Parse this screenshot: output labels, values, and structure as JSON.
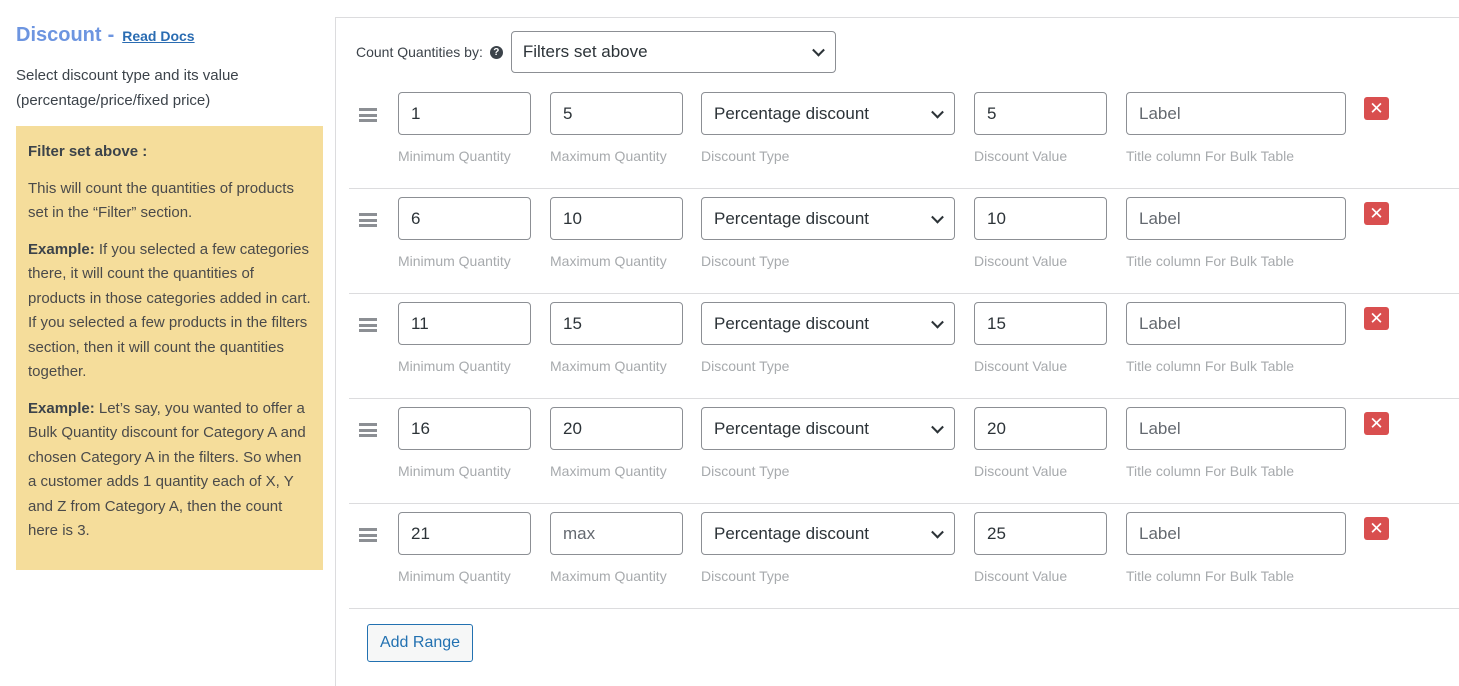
{
  "section": {
    "title": "Discount",
    "separator": "-",
    "docs_link": "Read Docs",
    "description": "Select discount type and its value (percentage/price/fixed price)"
  },
  "note": {
    "heading": "Filter set above :",
    "paragraph1": "This will count the quantities of products set in the “Filter” section.",
    "example1_label": "Example:",
    "example1_text": " If you selected a few categories there, it will count the quantities of products in those categories added in cart. If you selected a few products in the filters section, then it will count the quantities together.",
    "example2_label": "Example:",
    "example2_text": " Let’s say, you wanted to offer a Bulk Quantity discount for Category A and chosen Category A in the filters. So when a customer adds 1 quantity each of X, Y and Z from Category A, then the count here is 3."
  },
  "count_by": {
    "label": "Count Quantities by:",
    "help_icon": "question-circle-icon",
    "selected": "Filters set above"
  },
  "field_labels": {
    "min": "Minimum Quantity",
    "max": "Maximum Quantity",
    "type": "Discount Type",
    "value": "Discount Value",
    "title": "Title column For Bulk Table"
  },
  "ranges": [
    {
      "min": "1",
      "max": "5",
      "max_placeholder": "max",
      "type": "Percentage discount",
      "value": "5",
      "title": "",
      "title_placeholder": "Label"
    },
    {
      "min": "6",
      "max": "10",
      "max_placeholder": "max",
      "type": "Percentage discount",
      "value": "10",
      "title": "",
      "title_placeholder": "Label"
    },
    {
      "min": "11",
      "max": "15",
      "max_placeholder": "max",
      "type": "Percentage discount",
      "value": "15",
      "title": "",
      "title_placeholder": "Label"
    },
    {
      "min": "16",
      "max": "20",
      "max_placeholder": "max",
      "type": "Percentage discount",
      "value": "20",
      "title": "",
      "title_placeholder": "Label"
    },
    {
      "min": "21",
      "max": "",
      "max_placeholder": "max",
      "type": "Percentage discount",
      "value": "25",
      "title": "",
      "title_placeholder": "Label"
    }
  ],
  "icons": {
    "drag": "drag-handle-icon",
    "remove": "close-icon",
    "remove_glyph": "✕",
    "help_glyph": "?"
  },
  "add_button": "Add Range",
  "colors": {
    "title": "#6d95e0",
    "link": "#2a6cb2",
    "note_bg": "#f5dd9b",
    "remove_bg": "#d94f4f",
    "primary": "#2271b1"
  }
}
